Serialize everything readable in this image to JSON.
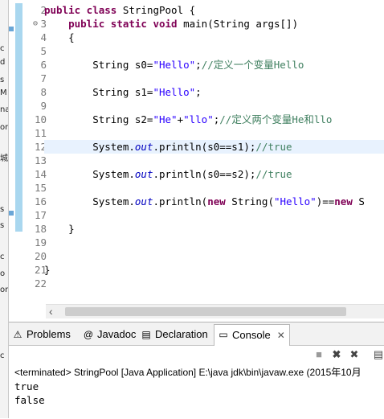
{
  "left_strip_fragments": [
    "c",
    "d",
    "s",
    "M",
    "na",
    "or",
    "城",
    "s",
    "s",
    "c",
    "o",
    "or",
    "c"
  ],
  "editor": {
    "line_numbers": [
      "2",
      "3",
      "4",
      "5",
      "6",
      "7",
      "8",
      "9",
      "10",
      "11",
      "12",
      "13",
      "14",
      "15",
      "16",
      "17",
      "18",
      "19",
      "20",
      "21",
      "22"
    ],
    "lines": [
      {
        "segments": [
          {
            "t": "public class",
            "c": "kw"
          },
          {
            "t": " StringPool {",
            "c": ""
          }
        ]
      },
      {
        "fold": "⊖",
        "segments": [
          {
            "t": "    ",
            "c": ""
          },
          {
            "t": "public static void",
            "c": "kw"
          },
          {
            "t": " main(String ",
            "c": ""
          },
          {
            "t": "args",
            "c": ""
          },
          {
            "t": "[])",
            "c": ""
          }
        ]
      },
      {
        "segments": [
          {
            "t": "    {",
            "c": ""
          }
        ]
      },
      {
        "segments": [
          {
            "t": "",
            "c": ""
          }
        ]
      },
      {
        "segments": [
          {
            "t": "        String s0=",
            "c": ""
          },
          {
            "t": "\"Hello\"",
            "c": "str"
          },
          {
            "t": ";",
            "c": ""
          },
          {
            "t": "//定义一个变量Hello",
            "c": "cmt"
          }
        ]
      },
      {
        "segments": [
          {
            "t": "",
            "c": ""
          }
        ]
      },
      {
        "segments": [
          {
            "t": "        String s1=",
            "c": ""
          },
          {
            "t": "\"Hello\"",
            "c": "str"
          },
          {
            "t": ";",
            "c": ""
          }
        ]
      },
      {
        "segments": [
          {
            "t": "",
            "c": ""
          }
        ]
      },
      {
        "segments": [
          {
            "t": "        String s2=",
            "c": ""
          },
          {
            "t": "\"He\"",
            "c": "str"
          },
          {
            "t": "+",
            "c": ""
          },
          {
            "t": "\"llo\"",
            "c": "str"
          },
          {
            "t": ";",
            "c": ""
          },
          {
            "t": "//定义两个变量He和llo",
            "c": "cmt"
          }
        ]
      },
      {
        "segments": [
          {
            "t": "",
            "c": ""
          }
        ]
      },
      {
        "current": true,
        "segments": [
          {
            "t": "        System.",
            "c": ""
          },
          {
            "t": "out",
            "c": "fld"
          },
          {
            "t": ".println(s0==s1);",
            "c": ""
          },
          {
            "t": "//true",
            "c": "cmt"
          }
        ]
      },
      {
        "segments": [
          {
            "t": "",
            "c": ""
          }
        ]
      },
      {
        "segments": [
          {
            "t": "        System.",
            "c": ""
          },
          {
            "t": "out",
            "c": "fld"
          },
          {
            "t": ".println(s0==s2);",
            "c": ""
          },
          {
            "t": "//true",
            "c": "cmt"
          }
        ]
      },
      {
        "segments": [
          {
            "t": "",
            "c": ""
          }
        ]
      },
      {
        "segments": [
          {
            "t": "        System.",
            "c": ""
          },
          {
            "t": "out",
            "c": "fld"
          },
          {
            "t": ".println(",
            "c": ""
          },
          {
            "t": "new",
            "c": "kw"
          },
          {
            "t": " String(",
            "c": ""
          },
          {
            "t": "\"Hello\"",
            "c": "str"
          },
          {
            "t": ")==",
            "c": ""
          },
          {
            "t": "new",
            "c": "kw"
          },
          {
            "t": " S",
            "c": ""
          }
        ]
      },
      {
        "segments": [
          {
            "t": "",
            "c": ""
          }
        ]
      },
      {
        "segments": [
          {
            "t": "    }",
            "c": ""
          }
        ]
      },
      {
        "segments": [
          {
            "t": "",
            "c": ""
          }
        ]
      },
      {
        "segments": [
          {
            "t": "",
            "c": ""
          }
        ]
      },
      {
        "segments": [
          {
            "t": "}",
            "c": ""
          }
        ]
      },
      {
        "segments": [
          {
            "t": "",
            "c": ""
          }
        ]
      }
    ]
  },
  "panel": {
    "tabs": [
      {
        "label": "Problems",
        "icon": "problems-icon",
        "glyph": "⚠"
      },
      {
        "label": "Javadoc",
        "icon": "javadoc-icon",
        "glyph": "@"
      },
      {
        "label": "Declaration",
        "icon": "declaration-icon",
        "glyph": "▤"
      },
      {
        "label": "Console",
        "icon": "console-icon",
        "glyph": "▭",
        "close": "✕"
      }
    ],
    "terminated_text": "<terminated> StringPool [Java Application] E:\\java jdk\\bin\\javaw.exe (2015年10月",
    "output": [
      "true",
      "false"
    ]
  },
  "colors": {
    "keyword": "#7f0055",
    "string": "#2a00ff",
    "comment": "#3f7f5f",
    "field": "#0000c0",
    "current_line": "#e8f2fe"
  }
}
